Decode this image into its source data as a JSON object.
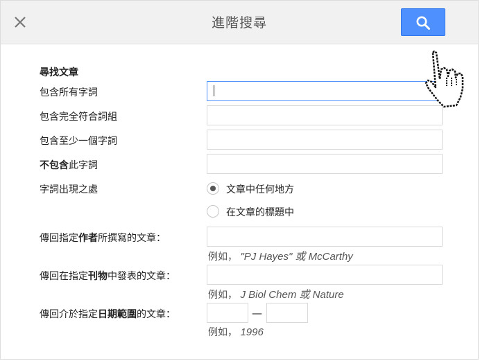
{
  "header": {
    "title": "進階搜尋",
    "close_icon": "close-icon",
    "search_icon": "search-icon",
    "accent_color": "#4d90fe"
  },
  "form": {
    "section_title": "尋找文章",
    "with_all_words": {
      "label": "包含所有字詞",
      "value": ""
    },
    "with_exact_phrase": {
      "label": "包含完全符合詞組",
      "value": ""
    },
    "with_at_least_one": {
      "label": "包含至少一個字詞",
      "value": ""
    },
    "without_words": {
      "label_bold": "不包含",
      "label_rest": "此字詞",
      "value": ""
    },
    "where_words_occur": {
      "label": "字詞出現之處",
      "options": [
        {
          "label": "文章中任何地方",
          "selected": true
        },
        {
          "label": "在文章的標題中",
          "selected": false
        }
      ]
    },
    "author": {
      "label_pre": "傳回指定",
      "label_bold": "作者",
      "label_post": "所撰寫的文章：",
      "value": "",
      "hint_prefix": "例如，",
      "hint_example": "\"PJ Hayes\" 或 McCarthy"
    },
    "published_in": {
      "label_pre": "傳回在指定",
      "label_bold": "刊物",
      "label_post": "中發表的文章：",
      "value": "",
      "hint_prefix": "例如，",
      "hint_example": "J Biol Chem 或 Nature"
    },
    "dated_between": {
      "label_pre": "傳回介於指定",
      "label_bold": "日期範圍",
      "label_post": "的文章：",
      "from": "",
      "separator": "—",
      "to": "",
      "hint_prefix": "例如，",
      "hint_example": "1996"
    }
  },
  "cursor_icon": "hand-pointer-icon"
}
